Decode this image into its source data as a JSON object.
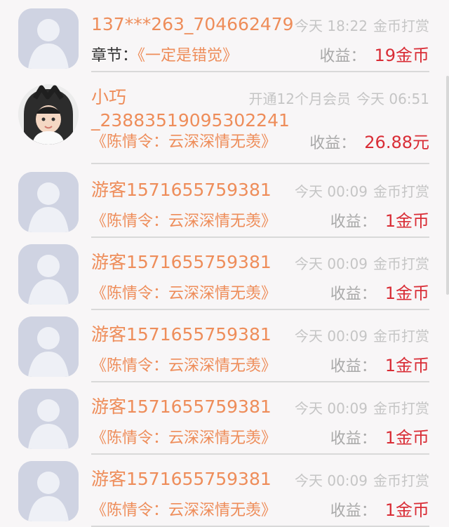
{
  "rows": [
    {
      "name": "137***263_704662479",
      "time": "今天 18:22",
      "action": "金币打赏",
      "chapter_label": "章节：",
      "chapter": "《一定是错觉》",
      "earn_label": "收益：",
      "earn_value": "19金币"
    },
    {
      "name": "小巧_23883519095302241",
      "time": "今天 06:51",
      "action": "开通12个月会员",
      "chapter": "《陈情令：云深深情无羡》",
      "earn_label": "收益：",
      "earn_value": "26.88元"
    },
    {
      "name": "游客1571655759381",
      "time": "今天 00:09",
      "action": "金币打赏",
      "chapter": "《陈情令：云深深情无羡》",
      "earn_label": "收益：",
      "earn_value": "1金币"
    },
    {
      "name": "游客1571655759381",
      "time": "今天 00:09",
      "action": "金币打赏",
      "chapter": "《陈情令：云深深情无羡》",
      "earn_label": "收益：",
      "earn_value": "1金币"
    },
    {
      "name": "游客1571655759381",
      "time": "今天 00:09",
      "action": "金币打赏",
      "chapter": "《陈情令：云深深情无羡》",
      "earn_label": "收益：",
      "earn_value": "1金币"
    },
    {
      "name": "游客1571655759381",
      "time": "今天 00:09",
      "action": "金币打赏",
      "chapter": "《陈情令：云深深情无羡》",
      "earn_label": "收益：",
      "earn_value": "1金币"
    },
    {
      "name": "游客1571655759381",
      "time": "今天 00:09",
      "action": "金币打赏",
      "chapter": "《陈情令：云深深情无羡》",
      "earn_label": "收益：",
      "earn_value": "1金币"
    }
  ],
  "colors": {
    "name": "#ee8d5a",
    "chapter_label": "#333333",
    "earn_label": "#a9a9a9",
    "earn_value": "#d92d36",
    "meta": "#c5c5c5",
    "background": "#f8f6f7"
  },
  "icons": {
    "default_avatar": "user-silhouette-icon",
    "photo_avatar": "child-photo-avatar"
  }
}
